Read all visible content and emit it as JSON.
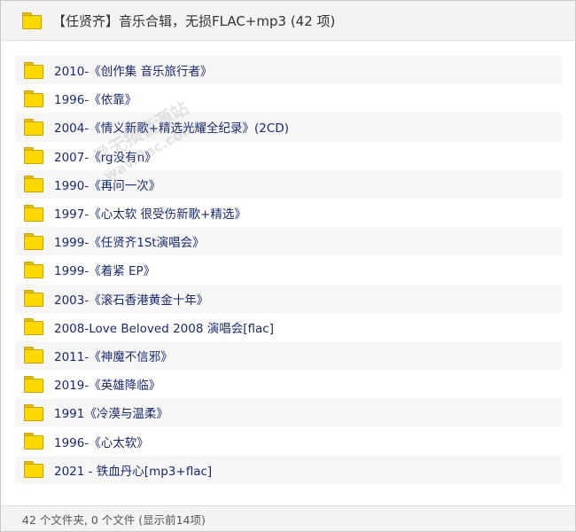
{
  "header": {
    "icon": "folder-icon",
    "title": "【任贤齐】音乐合辑，无损FLAC+mp3 (42 项)"
  },
  "folders": [
    {
      "label": "2010-《创作集 音乐旅行者》",
      "icon": "folder-icon"
    },
    {
      "label": "1996-《依靠》",
      "icon": "folder-icon"
    },
    {
      "label": "2004-《情义新歌+精选光耀全纪录》(2CD)",
      "icon": "folder-icon"
    },
    {
      "label": "2007-《rg没有n》",
      "icon": "folder-icon"
    },
    {
      "label": "1990-《再问一次》",
      "icon": "folder-icon"
    },
    {
      "label": "1997-《心太软 很受伤新歌+精选》",
      "icon": "folder-icon"
    },
    {
      "label": "1999-《任贤齐1St演唱会》",
      "icon": "folder-icon"
    },
    {
      "label": "1999-《着紧 EP》",
      "icon": "folder-icon"
    },
    {
      "label": "2003-《滚石香港黄金十年》",
      "icon": "folder-icon"
    },
    {
      "label": "2008-Love Beloved 2008 演唱会[flac]",
      "icon": "folder-icon"
    },
    {
      "label": "2011-《神魔不信邪》",
      "icon": "folder-icon"
    },
    {
      "label": "2019-《英雄降临》",
      "icon": "folder-icon"
    },
    {
      "label": "1991《冷漠与温柔》",
      "icon": "folder-icon"
    },
    {
      "label": "1996-《心太软》",
      "icon": "folder-icon"
    },
    {
      "label": "2021 - 铁血丹心[mp3+flac]",
      "icon": "folder-icon"
    }
  ],
  "footer": {
    "status": "42 个文件夹, 0 个文件 (显示前14项)"
  },
  "watermark": {
    "line1": "爱无损音源站",
    "line2": "wav.flac.com"
  },
  "colors": {
    "folder_fill": "#ffd800",
    "folder_border": "#c9a300",
    "label_text": "#1a2a6c",
    "alt_row": "#f6f6f6",
    "header_bg": "#f3f3f3"
  }
}
